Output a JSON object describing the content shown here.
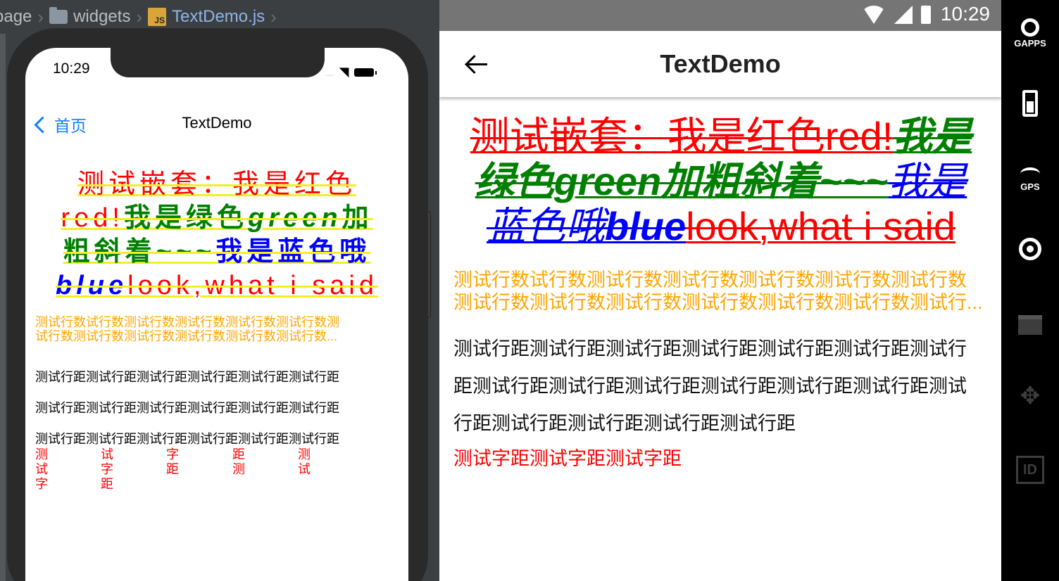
{
  "editor": {
    "breadcrumb": [
      "page",
      "widgets",
      "TextDemo.js"
    ],
    "file_type_badge": "JS"
  },
  "ios": {
    "time": "10:29",
    "signal": "....",
    "nav_back": "首页",
    "nav_title": "TextDemo",
    "nested_text": [
      {
        "text": "测试嵌套：",
        "style": "red"
      },
      {
        "text": "我是红色red!",
        "style": "red"
      },
      {
        "text": "我是绿色",
        "style": "green-bold"
      },
      {
        "text": "green",
        "style": "green-bold-italic"
      },
      {
        "text": "加粗斜着~~~",
        "style": "green-bold"
      },
      {
        "text": "我是蓝色哦",
        "style": "blue"
      },
      {
        "text": "blue",
        "style": "blue-bold-italic"
      },
      {
        "text": "look,what i said",
        "style": "red"
      }
    ],
    "line_number_text": [
      "测试行数试行数测试行数测试行数测试行数测试行数测",
      "试行数测试行数测试行数测试行数测试行数测试行数..."
    ],
    "line_spacing_text": [
      "测试行距测试行距测试行距测试行距测试行距测试行距",
      "测试行距测试行距测试行距测试行距测试行距测试行距",
      "测试行距测试行距测试行距测试行距测试行距测试行距"
    ],
    "letter_spacing_columns": [
      [
        "测",
        "试",
        "字"
      ],
      [
        "试",
        "字",
        "距"
      ],
      [
        "字",
        "距"
      ],
      [
        "距",
        "测"
      ],
      [
        "测",
        "试"
      ]
    ]
  },
  "android": {
    "time": "10:29",
    "title": "TextDemo",
    "nested_text": [
      {
        "text": "测试嵌套：",
        "style": "red"
      },
      {
        "text": "我是红色red!",
        "style": "red"
      },
      {
        "text": "我是绿色green加粗斜着~~~",
        "style": "green-bold-italic"
      },
      {
        "text": "我是蓝色哦",
        "style": "blue-italic"
      },
      {
        "text": "blue",
        "style": "blue-bold-italic"
      },
      {
        "text": "look,what i said",
        "style": "red"
      }
    ],
    "line_number_text": [
      "测试行数试行数测试行数测试行数测试行数测试行数测试行数",
      "测试行数测试行数测试行数测试行数测试行数测试行数测试行..."
    ],
    "line_spacing_text": [
      "测试行距测试行距测试行距测试行距测试行距测试行距测试行",
      "距测试行距测试行距测试行距测试行距测试行距测试行距测试",
      "行距测试行距测试行距测试行距测试行距"
    ],
    "letter_spacing_text": "测试字距测试字距测试字距"
  },
  "sidebar": {
    "gapps_label": "GAPPS",
    "gps_label": "GPS",
    "id_label": "ID"
  },
  "colors": {
    "orange": "#ffa500",
    "red": "#ff0000",
    "green": "#008000",
    "blue": "#0000ff",
    "ios_link": "#147efb",
    "decoration_yellow": "#f5ee25"
  }
}
